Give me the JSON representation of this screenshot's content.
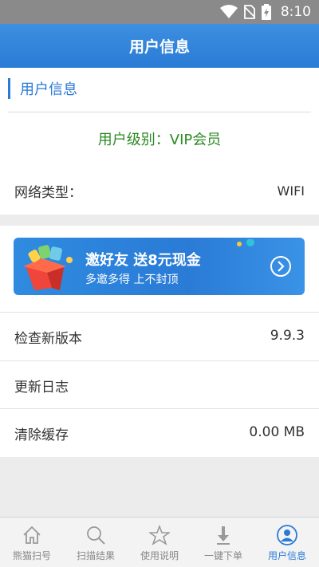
{
  "status_bar": {
    "time": "8:10"
  },
  "header": {
    "title": "用户信息"
  },
  "user_info": {
    "section_title": "用户信息",
    "vip_level": "用户级别：VIP会员",
    "network_label": "网络类型：",
    "network_value": "WIFI"
  },
  "banner": {
    "title": "邀好友  送8元现金",
    "subtitle": "多邀多得  上不封顶"
  },
  "settings": {
    "rows": [
      {
        "label": "检查新版本",
        "value": "9.9.3"
      },
      {
        "label": "更新日志",
        "value": ""
      },
      {
        "label": "清除缓存",
        "value": "0.00 MB"
      }
    ]
  },
  "tabs": [
    {
      "label": "熊猫扫号",
      "icon": "home-icon",
      "active": false
    },
    {
      "label": "扫描结果",
      "icon": "search-icon",
      "active": false
    },
    {
      "label": "使用说明",
      "icon": "star-icon",
      "active": false
    },
    {
      "label": "一键下单",
      "icon": "download-arrow-icon",
      "active": false
    },
    {
      "label": "用户信息",
      "icon": "user-icon",
      "active": true
    }
  ],
  "colors": {
    "accent": "#2a7bd6",
    "vip_text": "#2c8a24",
    "background": "#ececec"
  }
}
